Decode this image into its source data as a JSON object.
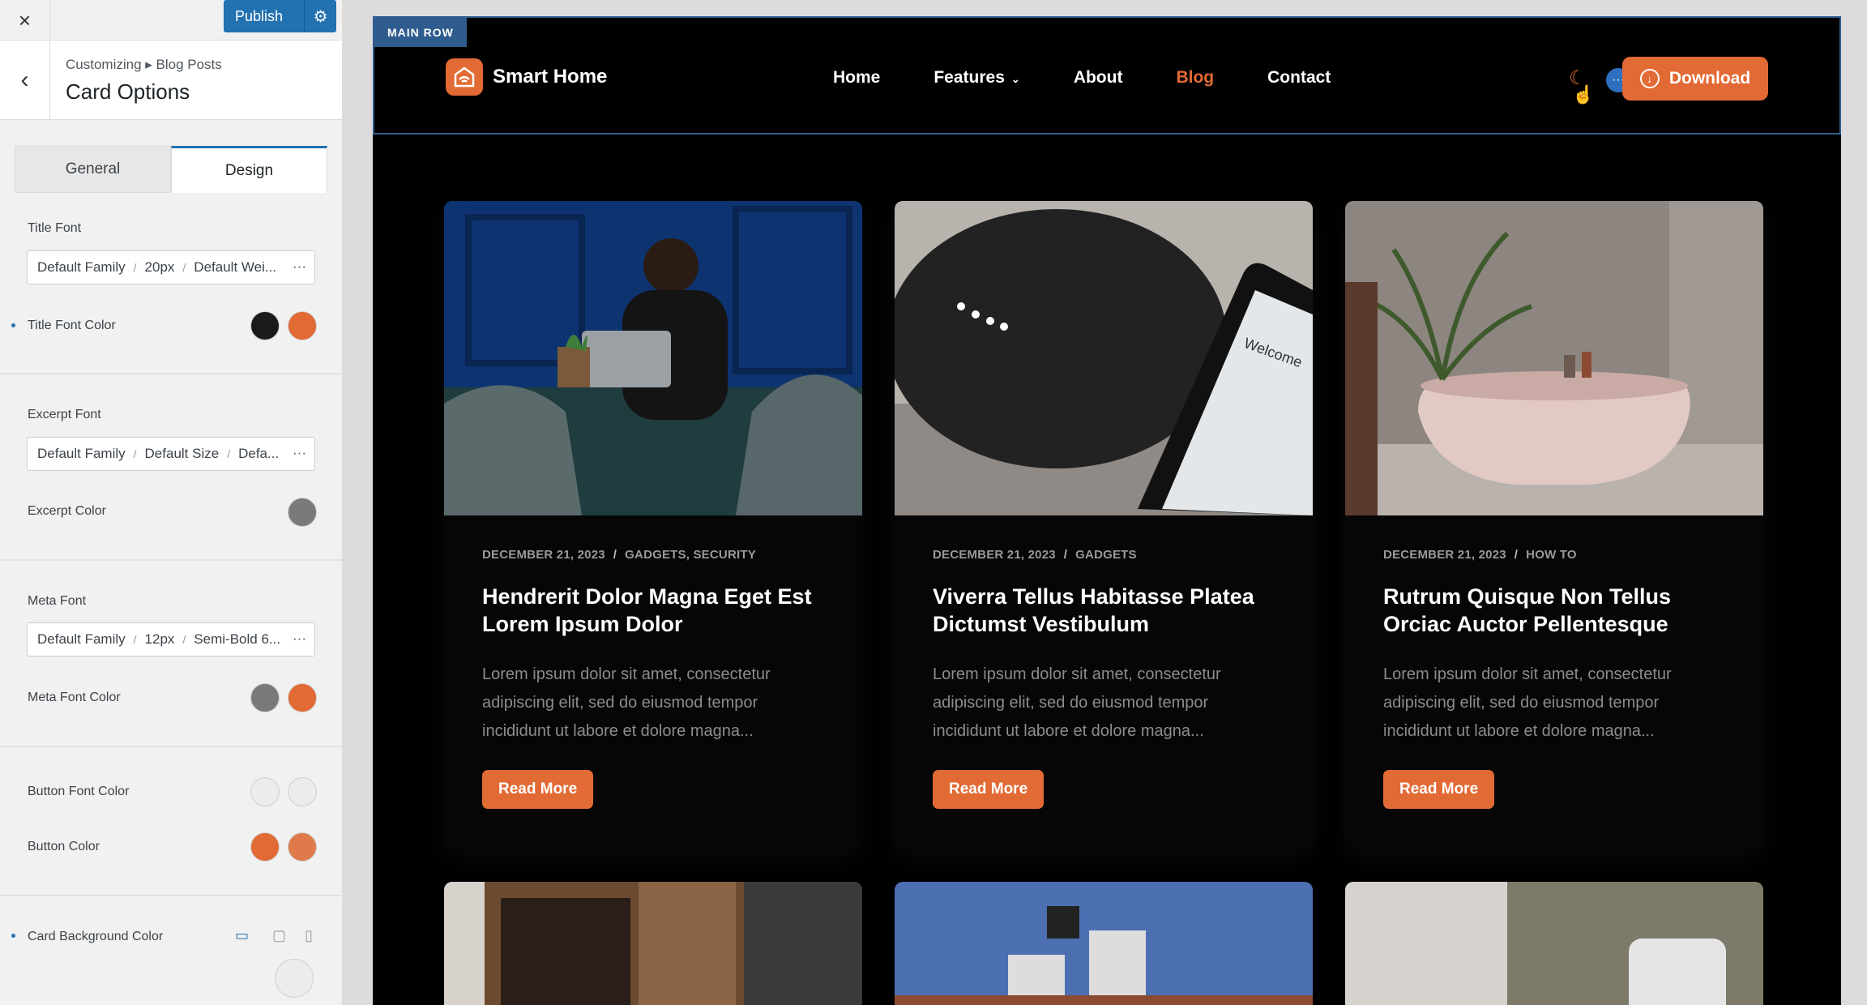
{
  "customizer": {
    "close_label": "×",
    "publish_label": "Publish",
    "breadcrumb": "Customizing ▸ Blog Posts",
    "section_title": "Card Options",
    "tabs": [
      {
        "label": "General"
      },
      {
        "label": "Design"
      }
    ],
    "controls": {
      "title_font": {
        "label": "Title Font",
        "family": "Default Family",
        "size": "20px",
        "weight": "Default Wei..."
      },
      "title_font_color": {
        "label": "Title Font Color",
        "colors": [
          "#1a1a1a",
          "#e26a34"
        ]
      },
      "excerpt_font": {
        "label": "Excerpt Font",
        "family": "Default Family",
        "size": "Default Size",
        "weight": "Defa..."
      },
      "excerpt_color": {
        "label": "Excerpt Color",
        "colors": [
          "#7a7a7a"
        ]
      },
      "meta_font": {
        "label": "Meta Font",
        "family": "Default Family",
        "size": "12px",
        "weight": "Semi-Bold 6..."
      },
      "meta_font_color": {
        "label": "Meta Font Color",
        "colors": [
          "#7a7a7a",
          "#e26a34"
        ]
      },
      "button_font_color": {
        "label": "Button Font Color",
        "colors": [
          "#ececec",
          "#ececec"
        ]
      },
      "button_color": {
        "label": "Button Color",
        "colors": [
          "#e26a34",
          "#e07a4a"
        ]
      },
      "card_background_color": {
        "label": "Card Background Color",
        "colors": [
          "#ececec"
        ]
      }
    },
    "more_glyph": "···"
  },
  "preview": {
    "row_tag": "MAIN ROW",
    "site_name": "Smart Home",
    "nav": [
      {
        "label": "Home"
      },
      {
        "label": "Features"
      },
      {
        "label": "About"
      },
      {
        "label": "Blog"
      },
      {
        "label": "Contact"
      }
    ],
    "download_label": "Download",
    "accent": "#e26a34",
    "posts": [
      {
        "date": "DECEMBER 21, 2023",
        "categories": "GADGETS, SECURITY",
        "title": "Hendrerit Dolor Magna Eget Est Lorem Ipsum Dolor",
        "excerpt": "Lorem ipsum dolor sit amet, consectetur adipiscing elit, sed do eiusmod tempor incididunt ut labore et dolore magna...",
        "button": "Read More"
      },
      {
        "date": "DECEMBER 21, 2023",
        "categories": "GADGETS",
        "title": "Viverra Tellus Habitasse Platea Dictumst Vestibulum",
        "excerpt": "Lorem ipsum dolor sit amet, consectetur adipiscing elit, sed do eiusmod tempor incididunt ut labore et dolore magna...",
        "button": "Read More"
      },
      {
        "date": "DECEMBER 21, 2023",
        "categories": "HOW TO",
        "title": "Rutrum Quisque Non Tellus Orciac Auctor Pellentesque",
        "excerpt": "Lorem ipsum dolor sit amet, consectetur adipiscing elit, sed do eiusmod tempor incididunt ut labore et dolore magna...",
        "button": "Read More"
      }
    ]
  }
}
